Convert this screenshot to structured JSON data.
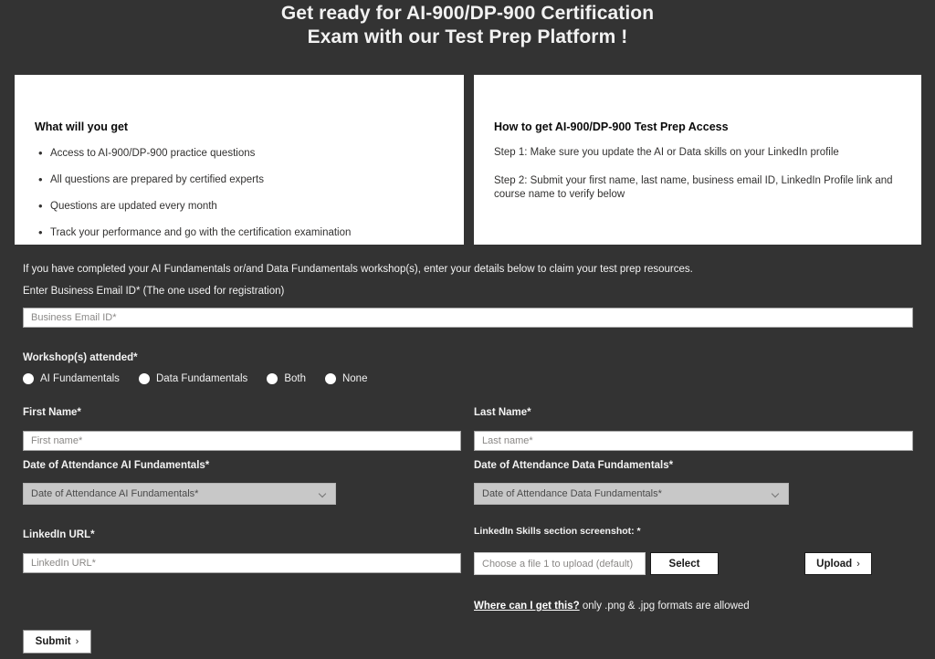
{
  "header": {
    "line1": "Get ready for AI-900/DP-900 Certification",
    "line2": "Exam with our Test Prep Platform !"
  },
  "cards": {
    "left": {
      "title": "What will you get",
      "bullets": [
        "Access to AI-900/DP-900 practice questions",
        "All questions are prepared by certified experts",
        "Questions are updated every month",
        "Track your performance and go with the certification examination"
      ]
    },
    "right": {
      "title": "How to get AI-900/DP-900 Test Prep Access",
      "steps": [
        "Step 1: Make sure you update the AI or Data skills on your LinkedIn profile",
        "Step 2: Submit your first name, last name, business email ID, LinkedIn Profile link and course name to verify below"
      ]
    }
  },
  "form": {
    "intro": "If you have completed your AI Fundamentals or/and Data Fundamentals workshop(s), enter your details below to claim your test prep resources.",
    "email": {
      "label": "Enter Business Email ID* (The one used for registration)",
      "placeholder": "Business Email ID*",
      "value": ""
    },
    "workshops": {
      "label": "Workshop(s) attended*",
      "options": [
        {
          "label": "AI Fundamentals",
          "selected": false
        },
        {
          "label": "Data Fundamentals",
          "selected": false
        },
        {
          "label": "Both",
          "selected": false
        },
        {
          "label": "None",
          "selected": false
        }
      ]
    },
    "first_name": {
      "label": "First Name*",
      "placeholder": "First name*",
      "value": ""
    },
    "last_name": {
      "label": "Last Name*",
      "placeholder": "Last name*",
      "value": ""
    },
    "date_ai": {
      "label": "Date of Attendance AI Fundamentals*",
      "selected": "Date of Attendance AI Fundamentals*"
    },
    "date_data": {
      "label": "Date of Attendance Data Fundamentals*",
      "selected": "Date of Attendance Data Fundamentals*"
    },
    "linkedin_url": {
      "label": "LinkedIn URL*",
      "placeholder": "LinkedIn URL*",
      "value": ""
    },
    "screenshot": {
      "label": "LinkedIn Skills section screenshot: *",
      "file_placeholder": "Choose a file 1 to upload (default)",
      "select_label": "Select",
      "upload_label": "Upload",
      "upload_chevron": "›"
    },
    "hint": {
      "link": "Where can I get this?",
      "text": " only .png & .jpg formats are allowed"
    },
    "submit": {
      "label": "Submit",
      "chevron": "›"
    }
  },
  "colors": {
    "background": "#333333",
    "card_bg": "#ffffff",
    "input_bg": "#ffffff",
    "select_bg": "#c8c8c8",
    "text_light": "#f3f3f3",
    "text_dark": "#1a1a1a",
    "placeholder": "#8a8886"
  }
}
